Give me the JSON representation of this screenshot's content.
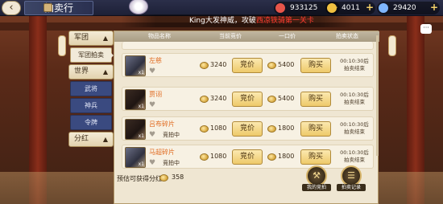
{
  "topbar": {
    "back_icon": "back-arrow-icon",
    "title": "拍卖行",
    "resources": [
      {
        "icon": "stamina-icon",
        "value": "933125",
        "color": "#e8554a"
      },
      {
        "icon": "gold-coin-icon",
        "value": "4011",
        "color": "#f0c040"
      },
      {
        "icon": "diamond-icon",
        "value": "29420",
        "color": "#7fb6ff"
      }
    ]
  },
  "marquee": {
    "prefix": "King大发神威，攻破",
    "highlight": "西凉铁骑第一关卡"
  },
  "nav": {
    "group1": "军团",
    "sub_active": "军团拍卖",
    "group2": "世界",
    "sub2": "武将",
    "sub3": "神兵",
    "sub4": "令牌",
    "group3": "分红"
  },
  "table": {
    "headers": [
      "物品名称",
      "当前竞价",
      "一口价",
      "拍卖状态"
    ],
    "rows": [
      {
        "name": "左慈",
        "count": "x1",
        "bid": "3240",
        "buyout": "5400",
        "bid_btn": "竞价",
        "buy_btn": "购买",
        "time": "00:10:30后",
        "time2": "拍卖结束",
        "status": ""
      },
      {
        "name": "贾诩",
        "count": "x1",
        "bid": "3240",
        "buyout": "5400",
        "bid_btn": "竞价",
        "buy_btn": "购买",
        "time": "00:10:30后",
        "time2": "拍卖结束",
        "status": ""
      },
      {
        "name": "吕布碎片",
        "count": "x1",
        "bid": "1080",
        "buyout": "1800",
        "bid_btn": "竞价",
        "buy_btn": "购买",
        "time": "00:10:30后",
        "time2": "拍卖结束",
        "status": "竞拍中"
      },
      {
        "name": "马超碎片",
        "count": "x1",
        "bid": "1080",
        "buyout": "1800",
        "bid_btn": "竞价",
        "buy_btn": "购买",
        "time": "00:10:30后",
        "time2": "拍卖结束",
        "status": "竞拍中"
      }
    ]
  },
  "footer": {
    "dividend_label": "预估可获得分红:",
    "dividend_value": "358",
    "my_bids": "我的竞拍",
    "records": "拍卖记录"
  },
  "chat_icon": "chat-bubble-icon"
}
